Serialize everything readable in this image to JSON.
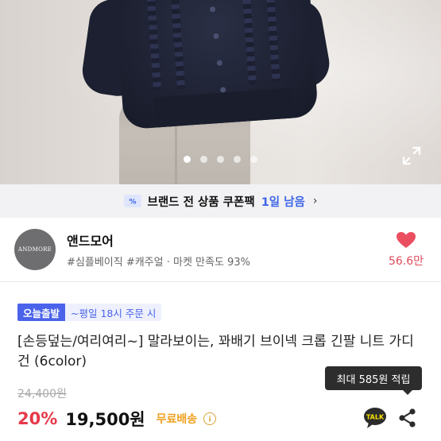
{
  "gallery": {
    "total_dots": 5,
    "active_index": 0
  },
  "coupon": {
    "title": "브랜드 전 상품 쿠폰팩",
    "remaining": "1일 남음",
    "chevron": "›",
    "accent": "#3f66e8"
  },
  "shop": {
    "logo_text": "ANDMORE",
    "name": "앤드모어",
    "tags": "#심플베이직 #캐주얼 · 마켓 만족도 93%",
    "likes": "56.6만",
    "like_color": "#e24a5a"
  },
  "product": {
    "badge_main": "오늘출발",
    "badge_sub": "~평일 18시 주문 시",
    "title": "[손등덮는/여리여리~] 말라보이는, 꽈배기 브이넥 크롭 긴팔 니트 가디건 (6color)",
    "original_price": "24,400원",
    "discount": "20%",
    "price": "19,500원",
    "shipping": "무료배송",
    "points_tooltip": "최대 585원 적립",
    "talk_label": "TALK",
    "discount_color": "#e6384a",
    "shipping_color": "#f0a020"
  }
}
